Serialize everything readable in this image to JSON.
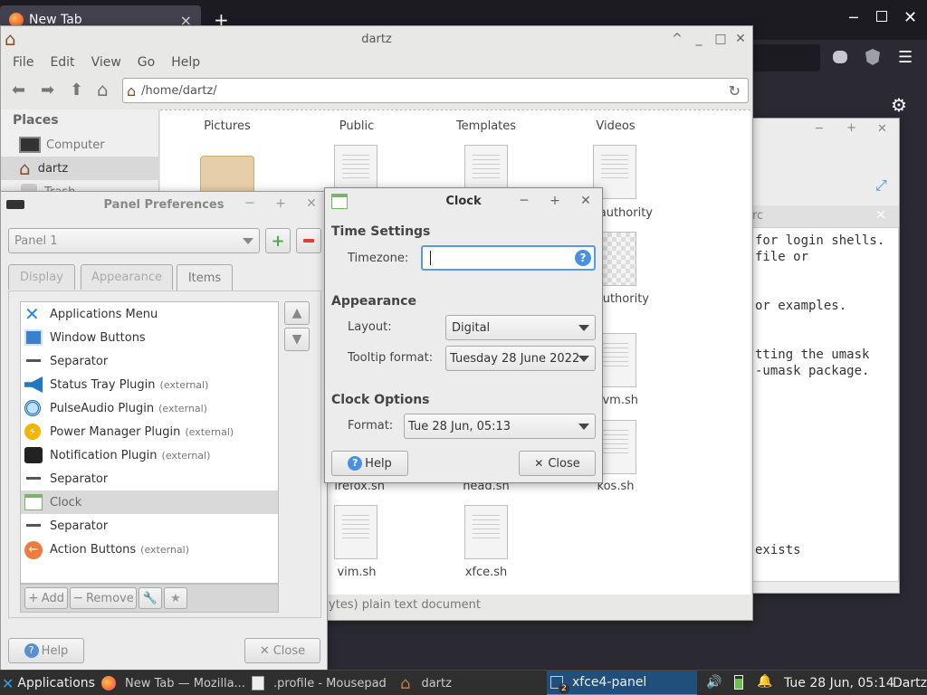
{
  "browser": {
    "tab_title": "New Tab",
    "close_tab": "×",
    "new_tab": "+"
  },
  "file_manager": {
    "title": "dartz",
    "menu": [
      "File",
      "Edit",
      "View",
      "Go",
      "Help"
    ],
    "path": "/home/dartz/",
    "places_header": "Places",
    "places": [
      "Computer",
      "dartz",
      "Trash"
    ],
    "files": [
      "Pictures",
      "Public",
      "Templates",
      "Videos",
      "authority",
      "uthority",
      "vm.sh",
      "irefox.sh",
      "head.sh",
      "kos.sh",
      "vim.sh",
      "xfce.sh"
    ],
    "status": "ytes) plain text document"
  },
  "editor": {
    "tab_fragment": "rc",
    "lines": [
      "for login shells.",
      "file or",
      "or examples.",
      "tting the umask",
      "-umask package.",
      "exists"
    ]
  },
  "panel_prefs": {
    "title": "Panel Preferences",
    "panel_selected": "Panel 1",
    "tabs": [
      "Display",
      "Appearance",
      "Items"
    ],
    "items": [
      {
        "name": "Applications Menu",
        "ext": ""
      },
      {
        "name": "Window Buttons",
        "ext": ""
      },
      {
        "name": "Separator",
        "ext": ""
      },
      {
        "name": "Status Tray Plugin",
        "ext": "(external)"
      },
      {
        "name": "PulseAudio Plugin",
        "ext": "(external)"
      },
      {
        "name": "Power Manager Plugin",
        "ext": "(external)"
      },
      {
        "name": "Notification Plugin",
        "ext": "(external)"
      },
      {
        "name": "Separator",
        "ext": ""
      },
      {
        "name": "Clock",
        "ext": ""
      },
      {
        "name": "Separator",
        "ext": ""
      },
      {
        "name": "Action Buttons",
        "ext": "(external)"
      }
    ],
    "add": "Add",
    "remove": "Remove",
    "help": "Help",
    "close": "Close"
  },
  "clock_dialog": {
    "title": "Clock",
    "time_settings": "Time Settings",
    "timezone_label": "Timezone:",
    "timezone_value": "",
    "appearance": "Appearance",
    "layout_label": "Layout:",
    "layout_value": "Digital",
    "tooltip_label": "Tooltip format:",
    "tooltip_value": "Tuesday 28 June 2022",
    "clock_options": "Clock Options",
    "format_label": "Format:",
    "format_value": "Tue 28 Jun, 05:13",
    "help": "Help",
    "close": "Close"
  },
  "taskbar": {
    "applications": "Applications",
    "tasks": [
      {
        "label": "New Tab — Mozilla..."
      },
      {
        "label": ".profile - Mousepad"
      },
      {
        "label": "dartz"
      },
      {
        "label": "xfce4-panel",
        "badge": "2"
      }
    ],
    "clock": "Tue 28 Jun, 05:14",
    "user": "Dartz"
  }
}
